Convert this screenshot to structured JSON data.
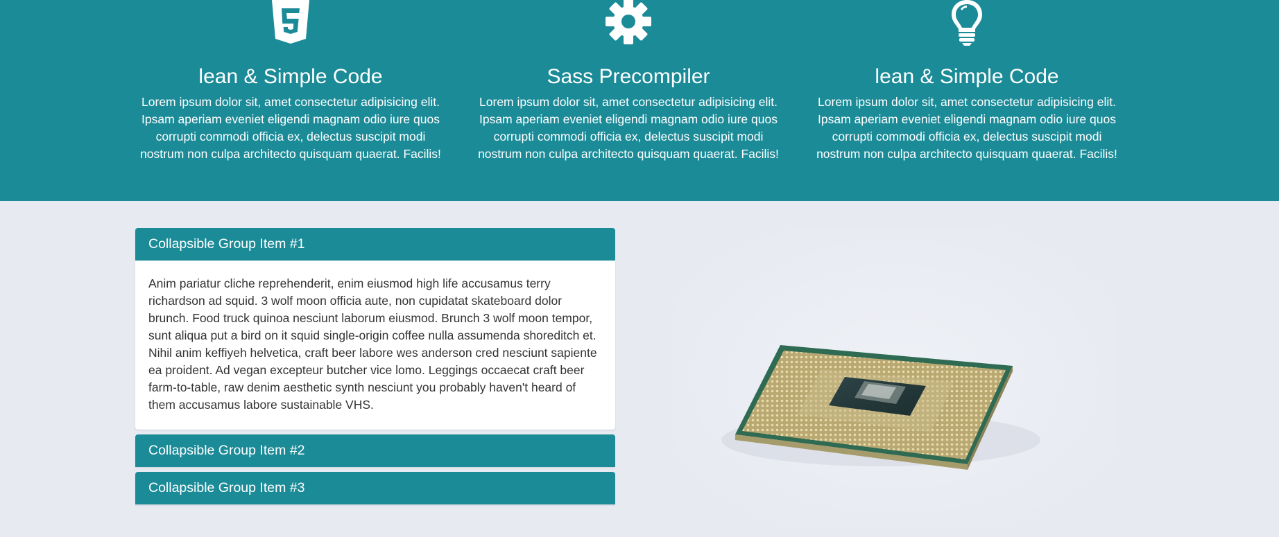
{
  "features": [
    {
      "icon": "html5-icon",
      "title": "lean & Simple Code",
      "text": "Lorem ipsum dolor sit, amet consectetur adipisicing elit. Ipsam aperiam eveniet eligendi magnam odio iure quos corrupti commodi officia ex, delectus suscipit modi nostrum non culpa architecto quisquam quaerat. Facilis!"
    },
    {
      "icon": "gear-icon",
      "title": "Sass Precompiler",
      "text": "Lorem ipsum dolor sit, amet consectetur adipisicing elit. Ipsam aperiam eveniet eligendi magnam odio iure quos corrupti commodi officia ex, delectus suscipit modi nostrum non culpa architecto quisquam quaerat. Facilis!"
    },
    {
      "icon": "lightbulb-icon",
      "title": "lean & Simple Code",
      "text": "Lorem ipsum dolor sit, amet consectetur adipisicing elit. Ipsam aperiam eveniet eligendi magnam odio iure quos corrupti commodi officia ex, delectus suscipit modi nostrum non culpa architecto quisquam quaerat. Facilis!"
    }
  ],
  "accordion": {
    "items": [
      {
        "title": "Collapsible Group Item #1",
        "expanded": true,
        "body": "Anim pariatur cliche reprehenderit, enim eiusmod high life accusamus terry richardson ad squid. 3 wolf moon officia aute, non cupidatat skateboard dolor brunch. Food truck quinoa nesciunt laborum eiusmod. Brunch 3 wolf moon tempor, sunt aliqua put a bird on it squid single-origin coffee nulla assumenda shoreditch et. Nihil anim keffiyeh helvetica, craft beer labore wes anderson cred nesciunt sapiente ea proident. Ad vegan excepteur butcher vice lomo. Leggings occaecat craft beer farm-to-table, raw denim aesthetic synth nesciunt you probably haven't heard of them accusamus labore sustainable VHS."
      },
      {
        "title": "Collapsible Group Item #2",
        "expanded": false
      },
      {
        "title": "Collapsible Group Item #3",
        "expanded": false
      }
    ]
  },
  "image": {
    "subject": "cpu-chip-image"
  },
  "colors": {
    "accent": "#1b8b98",
    "background": "#e7eaf1",
    "panel_body": "#ffffff",
    "text": "#333333"
  }
}
